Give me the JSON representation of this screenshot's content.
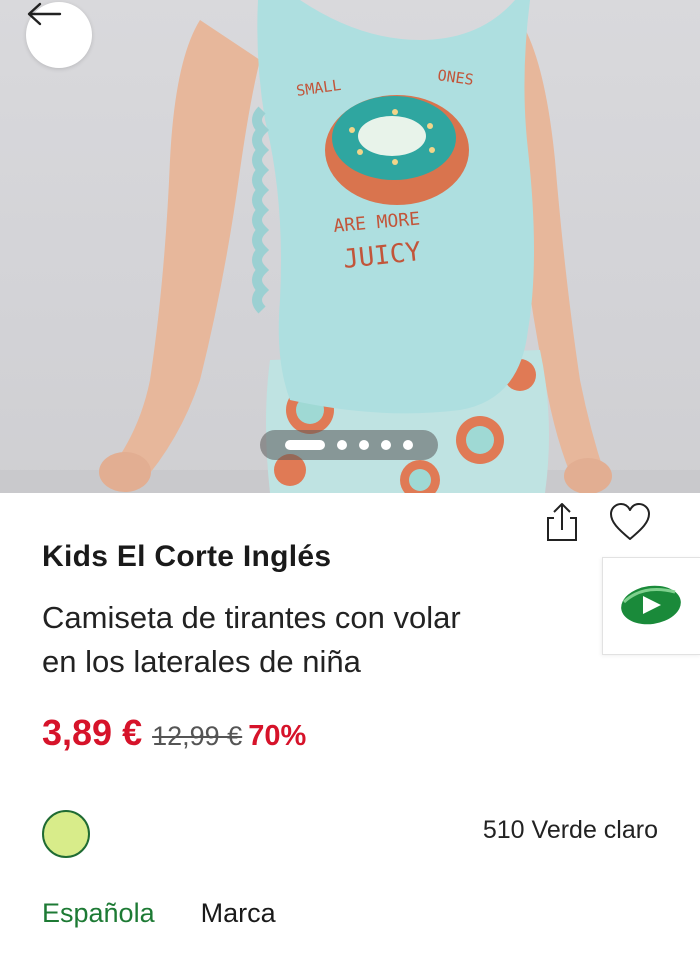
{
  "hero": {
    "shirt_print": [
      "SMALL",
      "ONES",
      "ARE MORE",
      "JUICY"
    ],
    "carousel": {
      "total": 5,
      "active": 0
    },
    "back_icon": "arrow-left-icon"
  },
  "actions": {
    "share_icon": "share-icon",
    "favorite_icon": "heart-icon",
    "promo_icon": "play-badge-icon"
  },
  "product": {
    "brand": "Kids El Corte Inglés",
    "title": "Camiseta de tirantes con volantes en los laterales de niña",
    "title_lines": [
      "Camiseta de tirantes con volar",
      "en los laterales de niña"
    ],
    "price": "3,89 €",
    "original_price": "12,99 €",
    "discount": "70%",
    "color_label": "510 Verde claro",
    "color_hex": "#d8ec8a"
  },
  "tabs": [
    {
      "label": "Española",
      "active": true
    },
    {
      "label": "Marca",
      "active": false
    }
  ],
  "colors": {
    "price_red": "#d6132a",
    "accent_green": "#1d7a34"
  }
}
